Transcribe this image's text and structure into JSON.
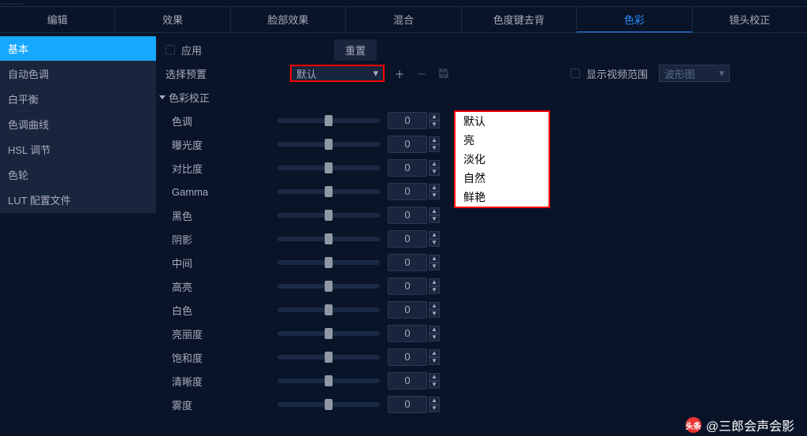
{
  "topTabs": {
    "items": [
      "编辑",
      "效果",
      "脸部效果",
      "混合",
      "色度键去背",
      "色彩",
      "镜头校正"
    ],
    "activeIndex": 5
  },
  "sidebar": {
    "items": [
      "基本",
      "自动色调",
      "白平衡",
      "色调曲线",
      "HSL 调节",
      "色轮",
      "LUT 配置文件"
    ],
    "activeIndex": 0
  },
  "apply": {
    "label": "应用",
    "checked": false
  },
  "reset_label": "重置",
  "preset_label": "选择预置",
  "preset_combo": {
    "value": "默认"
  },
  "preset_options": [
    "默认",
    "亮",
    "淡化",
    "自然",
    "鲜艳"
  ],
  "show_scope": {
    "label": "显示视频范围",
    "checked": false
  },
  "scope_type": "波形图",
  "section_title": "色彩校正",
  "params": [
    {
      "label": "色调",
      "value": 0
    },
    {
      "label": "曝光度",
      "value": 0
    },
    {
      "label": "对比度",
      "value": 0
    },
    {
      "label": "Gamma",
      "value": 0
    },
    {
      "label": "黑色",
      "value": 0
    },
    {
      "label": "阴影",
      "value": 0
    },
    {
      "label": "中间",
      "value": 0
    },
    {
      "label": "高亮",
      "value": 0
    },
    {
      "label": "白色",
      "value": 0
    },
    {
      "label": "亮丽度",
      "value": 0
    },
    {
      "label": "饱和度",
      "value": 0
    },
    {
      "label": "清晰度",
      "value": 0
    },
    {
      "label": "雾度",
      "value": 0
    }
  ],
  "watermark": {
    "logo_text": "头条",
    "author": "@三郎会声会影"
  }
}
